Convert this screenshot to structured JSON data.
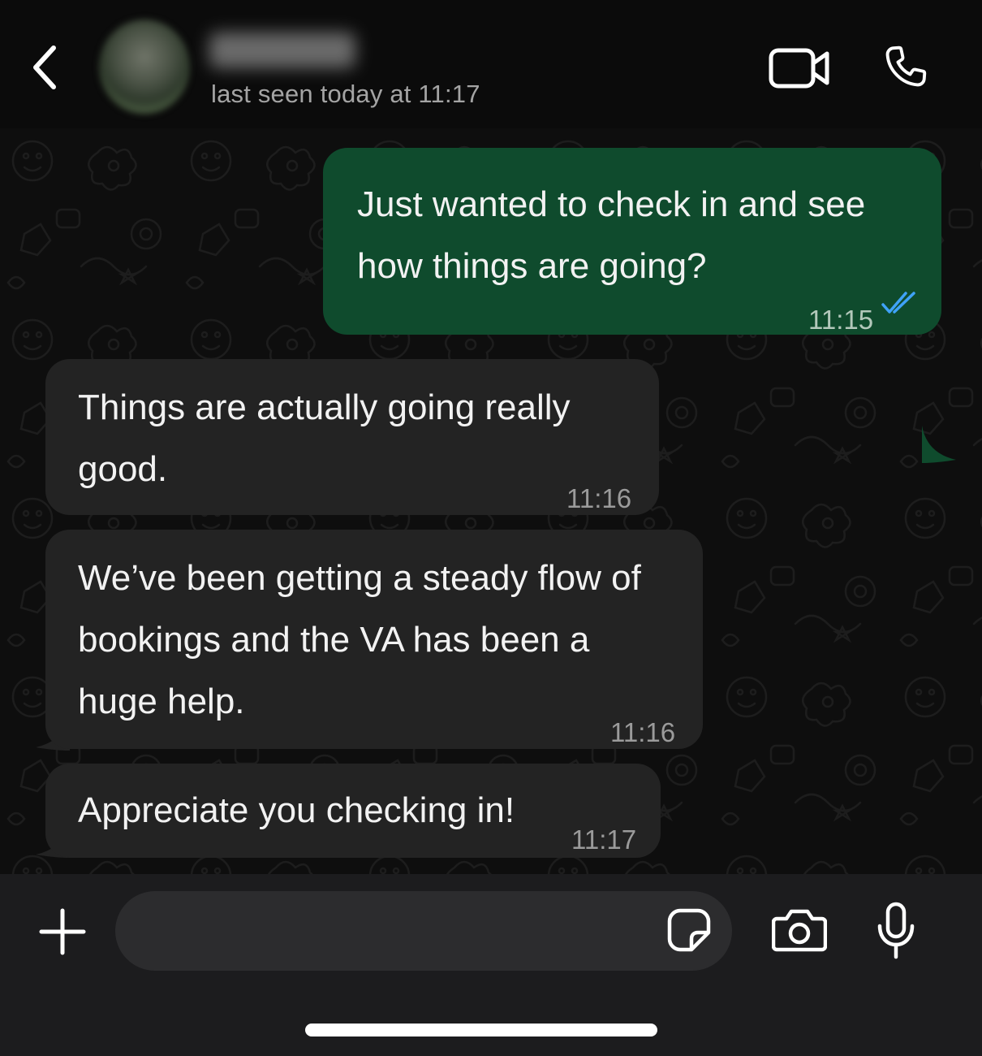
{
  "header": {
    "contact_status": "last seen today at 11:17"
  },
  "messages": [
    {
      "direction": "sent",
      "lines": [
        "Just wanted to check in and see",
        "how things are going?"
      ],
      "time": "11:15",
      "status": "read"
    },
    {
      "direction": "received",
      "lines": [
        "Things are actually going really",
        "good."
      ],
      "time": "11:16"
    },
    {
      "direction": "received",
      "lines": [
        "We’ve been getting a steady flow of",
        "bookings and the VA has been a",
        "huge help."
      ],
      "time": "11:16"
    },
    {
      "direction": "received",
      "lines": [
        "Appreciate you checking in!"
      ],
      "time": "11:17"
    }
  ],
  "input": {
    "value": "",
    "placeholder": ""
  },
  "icons": {
    "back": "chevron-left-icon",
    "video": "video-camera-icon",
    "call": "phone-icon",
    "attach": "plus-icon",
    "sticker": "sticker-icon",
    "camera": "camera-icon",
    "mic": "microphone-icon",
    "read_receipt": "double-check-icon"
  },
  "colors": {
    "background": "#0b0b0b",
    "sent_bubble": "#0f4b2d",
    "received_bubble": "#232323",
    "read_receipt": "#3fa2f7",
    "input_bar": "#1c1c1e"
  }
}
